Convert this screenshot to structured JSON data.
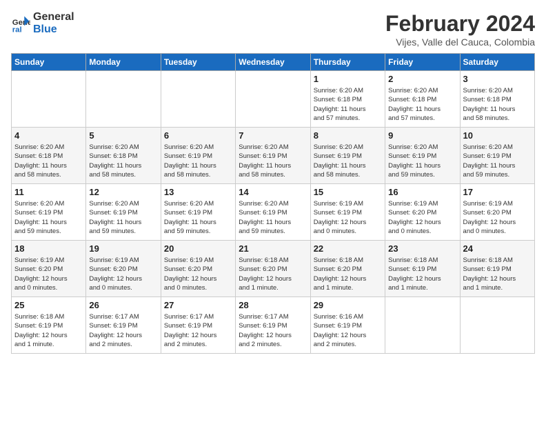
{
  "logo": {
    "line1": "General",
    "line2": "Blue"
  },
  "title": "February 2024",
  "location": "Vijes, Valle del Cauca, Colombia",
  "days_of_week": [
    "Sunday",
    "Monday",
    "Tuesday",
    "Wednesday",
    "Thursday",
    "Friday",
    "Saturday"
  ],
  "weeks": [
    [
      {
        "num": "",
        "info": ""
      },
      {
        "num": "",
        "info": ""
      },
      {
        "num": "",
        "info": ""
      },
      {
        "num": "",
        "info": ""
      },
      {
        "num": "1",
        "info": "Sunrise: 6:20 AM\nSunset: 6:18 PM\nDaylight: 11 hours\nand 57 minutes."
      },
      {
        "num": "2",
        "info": "Sunrise: 6:20 AM\nSunset: 6:18 PM\nDaylight: 11 hours\nand 57 minutes."
      },
      {
        "num": "3",
        "info": "Sunrise: 6:20 AM\nSunset: 6:18 PM\nDaylight: 11 hours\nand 58 minutes."
      }
    ],
    [
      {
        "num": "4",
        "info": "Sunrise: 6:20 AM\nSunset: 6:18 PM\nDaylight: 11 hours\nand 58 minutes."
      },
      {
        "num": "5",
        "info": "Sunrise: 6:20 AM\nSunset: 6:18 PM\nDaylight: 11 hours\nand 58 minutes."
      },
      {
        "num": "6",
        "info": "Sunrise: 6:20 AM\nSunset: 6:19 PM\nDaylight: 11 hours\nand 58 minutes."
      },
      {
        "num": "7",
        "info": "Sunrise: 6:20 AM\nSunset: 6:19 PM\nDaylight: 11 hours\nand 58 minutes."
      },
      {
        "num": "8",
        "info": "Sunrise: 6:20 AM\nSunset: 6:19 PM\nDaylight: 11 hours\nand 58 minutes."
      },
      {
        "num": "9",
        "info": "Sunrise: 6:20 AM\nSunset: 6:19 PM\nDaylight: 11 hours\nand 59 minutes."
      },
      {
        "num": "10",
        "info": "Sunrise: 6:20 AM\nSunset: 6:19 PM\nDaylight: 11 hours\nand 59 minutes."
      }
    ],
    [
      {
        "num": "11",
        "info": "Sunrise: 6:20 AM\nSunset: 6:19 PM\nDaylight: 11 hours\nand 59 minutes."
      },
      {
        "num": "12",
        "info": "Sunrise: 6:20 AM\nSunset: 6:19 PM\nDaylight: 11 hours\nand 59 minutes."
      },
      {
        "num": "13",
        "info": "Sunrise: 6:20 AM\nSunset: 6:19 PM\nDaylight: 11 hours\nand 59 minutes."
      },
      {
        "num": "14",
        "info": "Sunrise: 6:20 AM\nSunset: 6:19 PM\nDaylight: 11 hours\nand 59 minutes."
      },
      {
        "num": "15",
        "info": "Sunrise: 6:19 AM\nSunset: 6:19 PM\nDaylight: 12 hours\nand 0 minutes."
      },
      {
        "num": "16",
        "info": "Sunrise: 6:19 AM\nSunset: 6:20 PM\nDaylight: 12 hours\nand 0 minutes."
      },
      {
        "num": "17",
        "info": "Sunrise: 6:19 AM\nSunset: 6:20 PM\nDaylight: 12 hours\nand 0 minutes."
      }
    ],
    [
      {
        "num": "18",
        "info": "Sunrise: 6:19 AM\nSunset: 6:20 PM\nDaylight: 12 hours\nand 0 minutes."
      },
      {
        "num": "19",
        "info": "Sunrise: 6:19 AM\nSunset: 6:20 PM\nDaylight: 12 hours\nand 0 minutes."
      },
      {
        "num": "20",
        "info": "Sunrise: 6:19 AM\nSunset: 6:20 PM\nDaylight: 12 hours\nand 0 minutes."
      },
      {
        "num": "21",
        "info": "Sunrise: 6:18 AM\nSunset: 6:20 PM\nDaylight: 12 hours\nand 1 minute."
      },
      {
        "num": "22",
        "info": "Sunrise: 6:18 AM\nSunset: 6:20 PM\nDaylight: 12 hours\nand 1 minute."
      },
      {
        "num": "23",
        "info": "Sunrise: 6:18 AM\nSunset: 6:19 PM\nDaylight: 12 hours\nand 1 minute."
      },
      {
        "num": "24",
        "info": "Sunrise: 6:18 AM\nSunset: 6:19 PM\nDaylight: 12 hours\nand 1 minute."
      }
    ],
    [
      {
        "num": "25",
        "info": "Sunrise: 6:18 AM\nSunset: 6:19 PM\nDaylight: 12 hours\nand 1 minute."
      },
      {
        "num": "26",
        "info": "Sunrise: 6:17 AM\nSunset: 6:19 PM\nDaylight: 12 hours\nand 2 minutes."
      },
      {
        "num": "27",
        "info": "Sunrise: 6:17 AM\nSunset: 6:19 PM\nDaylight: 12 hours\nand 2 minutes."
      },
      {
        "num": "28",
        "info": "Sunrise: 6:17 AM\nSunset: 6:19 PM\nDaylight: 12 hours\nand 2 minutes."
      },
      {
        "num": "29",
        "info": "Sunrise: 6:16 AM\nSunset: 6:19 PM\nDaylight: 12 hours\nand 2 minutes."
      },
      {
        "num": "",
        "info": ""
      },
      {
        "num": "",
        "info": ""
      }
    ]
  ]
}
